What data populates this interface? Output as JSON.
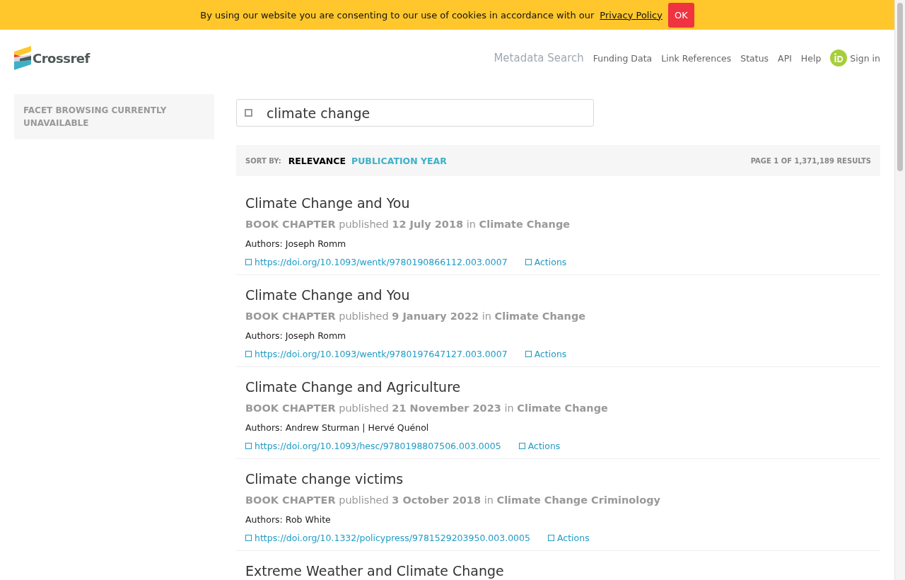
{
  "cookie_banner": {
    "message": "By using our website you are consenting to our use of cookies in accordance with our",
    "link": "Privacy Policy",
    "button": "OK"
  },
  "header": {
    "logo": "Crossref",
    "nav": [
      {
        "label": "Metadata Search",
        "selected": true
      },
      {
        "label": "Funding Data",
        "selected": false
      },
      {
        "label": "Link References",
        "selected": false
      },
      {
        "label": "Status",
        "selected": false
      },
      {
        "label": "API",
        "selected": false
      },
      {
        "label": "Help",
        "selected": false
      }
    ],
    "sign_in": "Sign in"
  },
  "sidebar": {
    "notice": "FACET BROWSING CURRENTLY UNAVAILABLE"
  },
  "search": {
    "value": "climate change"
  },
  "sort_bar": {
    "label": "SORT BY:",
    "options": [
      {
        "label": "RELEVANCE",
        "selected": true
      },
      {
        "label": "PUBLICATION YEAR",
        "selected": false
      }
    ],
    "page_info": "PAGE 1 OF 1,371,189 RESULTS"
  },
  "results": [
    {
      "title": "Climate Change and You",
      "meta": "**BOOK CHAPTER** published **12 July 2018** in **Climate Change**",
      "authors": "Authors: Joseph Romm",
      "doi": "https://doi.org/10.1093/wentk/9780190866112.003.0007",
      "actions": "Actions"
    },
    {
      "title": "Climate Change and You",
      "meta": "**BOOK CHAPTER** published **9 January 2022** in **Climate Change**",
      "authors": "Authors: Joseph Romm",
      "doi": "https://doi.org/10.1093/wentk/9780197647127.003.0007",
      "actions": "Actions"
    },
    {
      "title": "Climate Change and Agriculture",
      "meta": "**BOOK CHAPTER** published **21 November 2023** in **Climate Change**",
      "authors": "Authors: Andrew Sturman | Hervé Quénol",
      "doi": "https://doi.org/10.1093/hesc/9780198807506.003.0005",
      "actions": "Actions"
    },
    {
      "title": "Climate change victims",
      "meta": "**BOOK CHAPTER** published **3 October 2018** in **Climate Change Criminology**",
      "authors": "Authors: Rob White",
      "doi": "https://doi.org/10.1332/policypress/9781529203950.003.0005",
      "actions": "Actions"
    },
    {
      "title": "Extreme Weather and Climate Change"
    }
  ]
}
